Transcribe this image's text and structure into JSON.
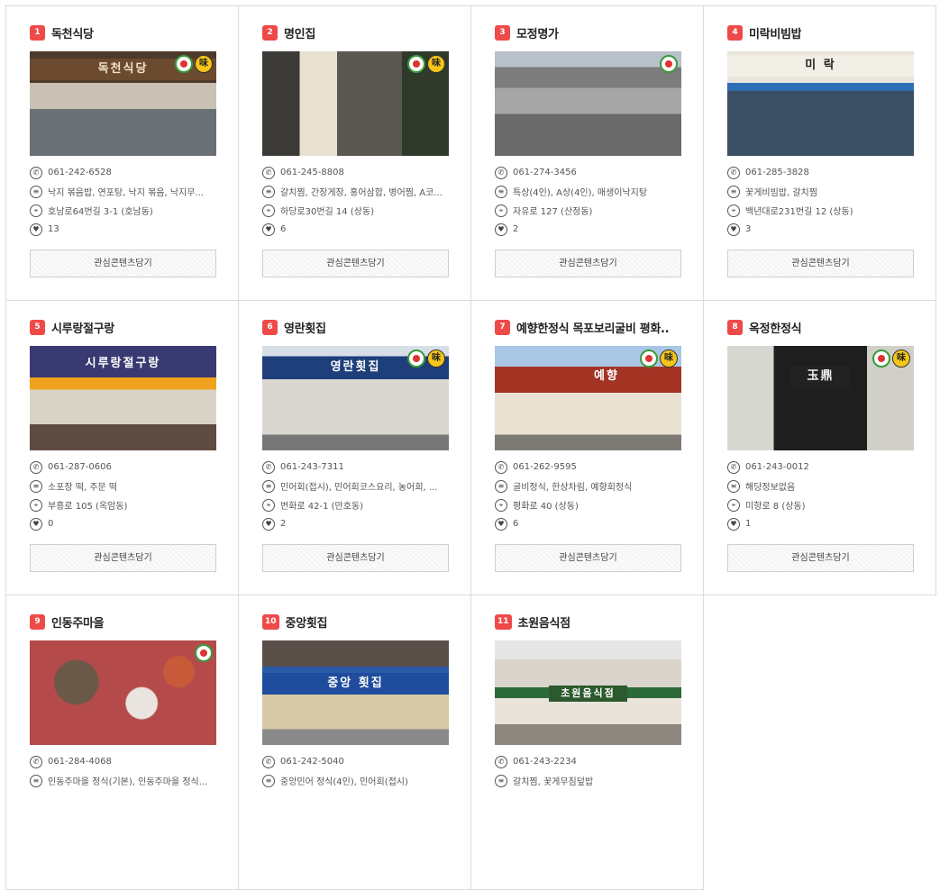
{
  "button_label": "관심콘텐츠담기",
  "restaurants": [
    {
      "num": "1",
      "name": "독천식당",
      "phone": "061-242-6528",
      "menu": "낙지 볶음밥, 연포탕, 낙지 볶음, 낙지무...",
      "address": "호남로64번길 3-1 (호남동)",
      "likes": "13",
      "sign": "독천식당",
      "badges": [
        "a",
        "b"
      ]
    },
    {
      "num": "2",
      "name": "명인집",
      "phone": "061-245-8808",
      "menu": "갈치찜, 간장게장, 홍어삼합, 병어찜, A코...",
      "address": "하당로30번길 14 (상동)",
      "likes": "6",
      "sign": "",
      "badges": [
        "a",
        "b"
      ]
    },
    {
      "num": "3",
      "name": "모정명가",
      "phone": "061-274-3456",
      "menu": "특상(4인), A상(4인), 매생이낙지탕",
      "address": "자유로 127 (산정동)",
      "likes": "2",
      "sign": "",
      "badges": [
        "a"
      ]
    },
    {
      "num": "4",
      "name": "미락비빔밥",
      "phone": "061-285-3828",
      "menu": "꽃게비빔밥, 갈치찜",
      "address": "백년대로231번길 12 (상동)",
      "likes": "3",
      "sign": "미 락",
      "badges": []
    },
    {
      "num": "5",
      "name": "시루랑절구랑",
      "phone": "061-287-0606",
      "menu": "소포장 떡, 주문 떡",
      "address": "부흥로 105 (옥암동)",
      "likes": "0",
      "sign": "시루랑절구랑",
      "badges": []
    },
    {
      "num": "6",
      "name": "영란횟집",
      "phone": "061-243-7311",
      "menu": "민어회(접시), 민어회코스요리, 농어회, ...",
      "address": "번화로 42-1 (만호동)",
      "likes": "2",
      "sign": "영란횟집",
      "badges": [
        "a",
        "b"
      ]
    },
    {
      "num": "7",
      "name": "예향한정식 목포보리굴비 평화..",
      "phone": "061-262-9595",
      "menu": "굴비정식, 한상차림, 예향회정식",
      "address": "평화로 40 (상동)",
      "likes": "6",
      "sign": "예향",
      "badges": [
        "a",
        "b"
      ]
    },
    {
      "num": "8",
      "name": "옥정한정식",
      "phone": "061-243-0012",
      "menu": "해당정보없음",
      "address": "미항로 8 (상동)",
      "likes": "1",
      "sign": "玉鼎",
      "badges": [
        "a",
        "b"
      ]
    },
    {
      "num": "9",
      "name": "인동주마을",
      "phone": "061-284-4068",
      "menu": "인동주마을 정식(기본), 인동주마을 정식...",
      "address": "",
      "likes": "",
      "sign": "",
      "badges": [
        "a"
      ]
    },
    {
      "num": "10",
      "name": "중앙횟집",
      "phone": "061-242-5040",
      "menu": "중앙민어 정식(4인), 민어회(접시)",
      "address": "",
      "likes": "",
      "sign": "중앙 횟집",
      "badges": []
    },
    {
      "num": "11",
      "name": "초원음식점",
      "phone": "061-243-2234",
      "menu": "갈치찜, 꽃게무침덮밥",
      "address": "",
      "likes": "",
      "sign": "초원음식점",
      "badges": []
    }
  ],
  "icons": {
    "phone": "phone-icon",
    "menu": "menu-list-icon",
    "address": "location-pin-icon",
    "likes": "heart-icon",
    "badge_a": "certified-restaurant-badge-icon",
    "badge_b": "taste-mark-badge-icon"
  },
  "badge_b_text": "味"
}
